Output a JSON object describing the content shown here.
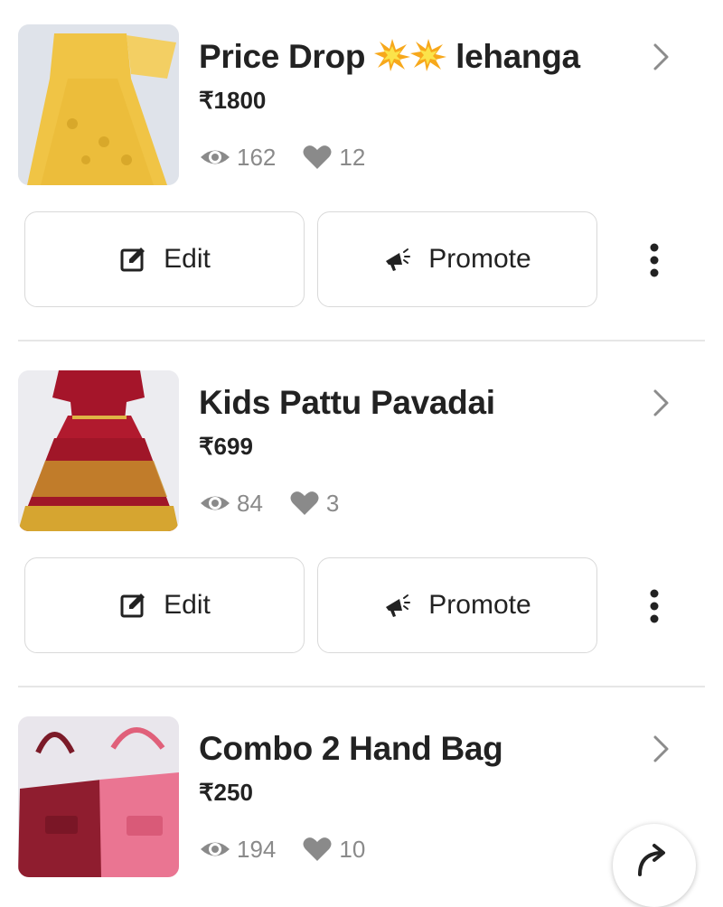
{
  "listings": [
    {
      "title_pre": "Price Drop",
      "title_post": "lehanga",
      "price": "₹1800",
      "views": "162",
      "likes": "12",
      "edit_label": "Edit",
      "promote_label": "Promote",
      "thumb_colors": [
        "#f2c64a",
        "#e8d9a8"
      ]
    },
    {
      "title": "Kids Pattu Pavadai",
      "price": "₹699",
      "views": "84",
      "likes": "3",
      "edit_label": "Edit",
      "promote_label": "Promote",
      "thumb_colors": [
        "#a8182c",
        "#d8a52a"
      ]
    },
    {
      "title": "Combo 2 Hand Bag",
      "price": "₹250",
      "views": "194",
      "likes": "10"
    }
  ],
  "colors": {
    "text": "#222222",
    "muted": "#8a8a8a",
    "border": "#d9d9d9"
  }
}
